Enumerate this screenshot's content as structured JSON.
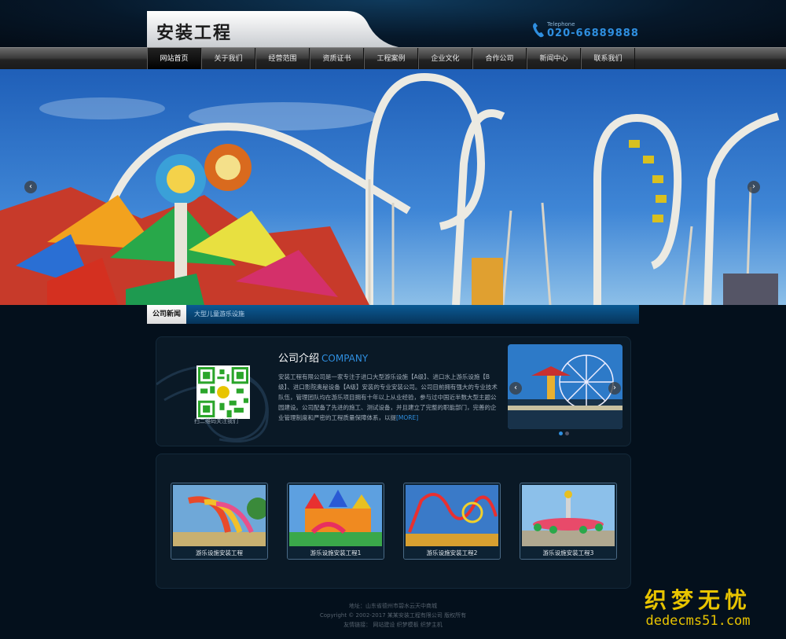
{
  "header": {
    "logo_text": "安装工程",
    "telephone_label": "Telephone",
    "telephone_number": "020-66889888"
  },
  "nav": {
    "items": [
      "网站首页",
      "关于我们",
      "经营范围",
      "资质证书",
      "工程案例",
      "企业文化",
      "合作公司",
      "新闻中心",
      "联系我们"
    ],
    "active_index": 0
  },
  "banner": {
    "prev_label": "‹",
    "next_label": "›"
  },
  "news": {
    "tab_label": "公司新闻",
    "headline": "大型儿童游乐设施"
  },
  "about": {
    "title": "公司介绍",
    "title_en": "COMPANY",
    "body": "安装工程有限公司是一家专注于进口大型游乐设施【A级】、进口水上游乐设施【B级】、进口影院奥秘设备【A级】安装的专业安装公司。公司目前拥有强大的专业技术队伍，管理团队均在游乐项目拥有十年以上从业经验，参与过中国近半数大型主题公园建设。公司配备了先进的施工、测试设备，并且建立了完整的职能部门，完善的企业管理制度和严密的工程质量保障体系，以提",
    "more_label": "[MORE]",
    "qr_caption": "扫二维码关注我们",
    "slider_dots": 2,
    "slider_active": 1
  },
  "products": [
    {
      "caption": "游乐设施安装工程"
    },
    {
      "caption": "游乐设施安装工程1"
    },
    {
      "caption": "游乐设施安装工程2"
    },
    {
      "caption": "游乐设施安装工程3"
    }
  ],
  "footer": {
    "address_label": "地址：",
    "address": "山东省德州市碧水云天中商城",
    "copyright": "Copyright © 2002-2017 某某安装工程有限公司 版权所有",
    "links_label": "友情链接：",
    "links": [
      "网站建设",
      "织梦模板",
      "织梦主机"
    ]
  },
  "watermark": {
    "cn": "织梦无忧",
    "en": "dedecms51.com"
  },
  "colors": {
    "accent_blue": "#2f8fe0",
    "background": "#04101c",
    "watermark": "#e8c400"
  }
}
